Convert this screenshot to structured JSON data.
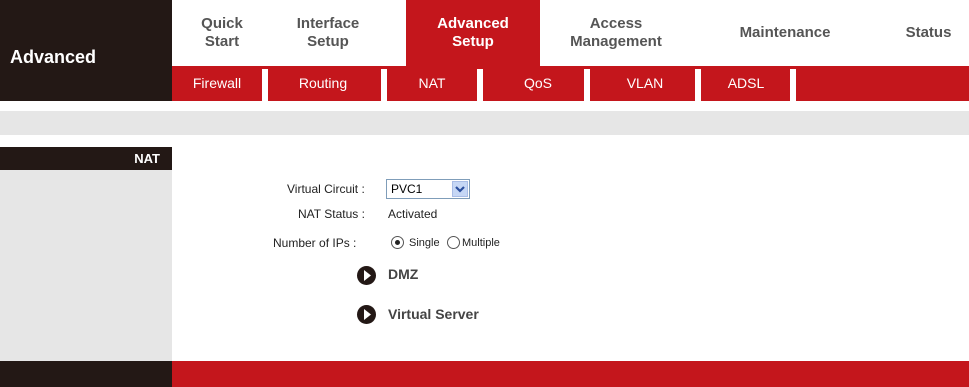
{
  "brand": {
    "label": "Advanced"
  },
  "tabs": [
    {
      "line1": "Quick",
      "line2": "Start"
    },
    {
      "line1": "Interface",
      "line2": "Setup"
    },
    {
      "line1": "Advanced",
      "line2": "Setup"
    },
    {
      "line1": "Access",
      "line2": "Management"
    },
    {
      "line1": "Maintenance",
      "line2": ""
    },
    {
      "line1": "Status",
      "line2": ""
    }
  ],
  "subnav": [
    "Firewall",
    "Routing",
    "NAT",
    "QoS",
    "VLAN",
    "ADSL"
  ],
  "section": {
    "label": "NAT"
  },
  "form": {
    "virtual_circuit_label": "Virtual Circuit :",
    "virtual_circuit_value": "PVC1",
    "nat_status_label": "NAT Status :",
    "nat_status_value": "Activated",
    "number_ips_label": "Number of IPs :",
    "option_single": "Single",
    "option_multiple": "Multiple",
    "selected_option": "Single"
  },
  "links": {
    "dmz": "DMZ",
    "virtual_server": "Virtual Server"
  },
  "colors": {
    "accent": "#c4161c",
    "dark": "#231815",
    "light_gray": "#e6e6e6"
  }
}
